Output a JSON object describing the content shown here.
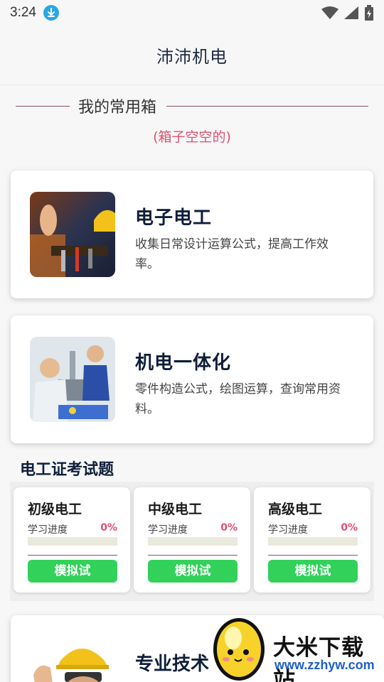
{
  "status_bar": {
    "time": "3:24",
    "icons": [
      "download-icon",
      "wifi-icon",
      "signal-icon",
      "battery-icon"
    ]
  },
  "header": {
    "title": "沛沛机电"
  },
  "toolbox": {
    "title": "我的常用箱",
    "empty_hint": "(箱子空空的)"
  },
  "features": [
    {
      "title": "电子电工",
      "desc": "收集日常设计运算公式，提高工作效率。",
      "image": "electrician-tool-belt-photo"
    },
    {
      "title": "机电一体化",
      "desc": "零件构造公式，绘图运算，查询常用资料。",
      "image": "mechatronics-workers-photo"
    }
  ],
  "exams": {
    "title": "电工证考试题",
    "items": [
      {
        "level": "初级电工",
        "progress_label": "学习进度",
        "progress": "0%",
        "button": "模拟试"
      },
      {
        "level": "中级电工",
        "progress_label": "学习进度",
        "progress": "0%",
        "button": "模拟试"
      },
      {
        "level": "高级电工",
        "progress_label": "学习进度",
        "progress": "0%",
        "button": "模拟试"
      }
    ]
  },
  "bottom_card": {
    "title": "专业技术",
    "image": "hardhat-worker-photo"
  },
  "watermark": {
    "text": "大米下载站",
    "url": "www.zzhyw.com"
  },
  "colors": {
    "accent_pink": "#e0506e",
    "button_green": "#31d15a",
    "title_navy": "#0f1e3a"
  }
}
